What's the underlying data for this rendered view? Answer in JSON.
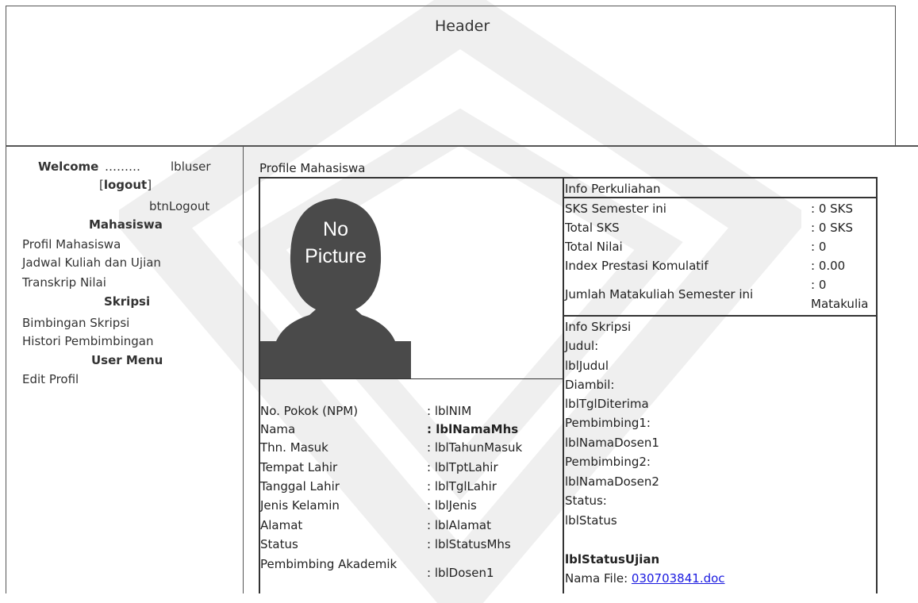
{
  "header": {
    "title": "Header"
  },
  "sidebar": {
    "welcome_label": "Welcome",
    "welcome_dots": "………",
    "user_label": "lbluser",
    "logout_open": "[",
    "logout_label": "logout",
    "logout_close": "]",
    "logout_control": "btnLogout",
    "sections": [
      {
        "title": "Mahasiswa",
        "items": [
          "Profil Mahasiswa",
          "Jadwal Kuliah dan Ujian",
          "Transkrip Nilai"
        ]
      },
      {
        "title": "Skripsi",
        "items": [
          "Bimbingan Skripsi",
          "Histori Pembimbingan"
        ]
      },
      {
        "title": "User Menu",
        "items": [
          "Edit Profil"
        ]
      }
    ]
  },
  "main": {
    "title": "Profile Mahasiswa",
    "photo": {
      "line1": "No",
      "line2": "Picture"
    },
    "profile": [
      {
        "label": "No. Pokok (NPM)",
        "value": ": lblNIM"
      },
      {
        "label": "Nama",
        "value": ": lblNamaMhs"
      },
      {
        "label": "Thn. Masuk",
        "value": ": lblTahunMasuk"
      },
      {
        "label": "Tempat Lahir",
        "value": ": lblTptLahir"
      },
      {
        "label": "Tanggal Lahir",
        "value": ": lblTglLahir"
      },
      {
        "label": "Jenis Kelamin",
        "value": ": lblJenis"
      },
      {
        "label": "Alamat",
        "value": ": lblAlamat"
      },
      {
        "label": "Status",
        "value": ": lblStatusMhs"
      },
      {
        "label": "Pembimbing Akademik",
        "value": ": lblDosen1"
      }
    ],
    "info_perkuliahan": {
      "title": "Info Perkuliahan",
      "rows": [
        {
          "label": "SKS Semester ini",
          "value": ": 0 SKS"
        },
        {
          "label": "Total SKS",
          "value": ": 0 SKS"
        },
        {
          "label": "Total Nilai",
          "value": ": 0"
        },
        {
          "label": "Index Prestasi Komulatif",
          "value": ": 0.00"
        },
        {
          "label": "Jumlah Matakuliah Semester ini",
          "value_line1": ": 0",
          "value_line2": "Matakulia"
        }
      ]
    },
    "info_skripsi": {
      "title": "Info Skripsi",
      "lines": [
        "Judul:",
        "lblJudul",
        "Diambil:",
        "lblTglDiterima",
        "Pembimbing1:",
        "lblNamaDosen1",
        "Pembimbing2:",
        "lblNamaDosen2",
        "Status:",
        "lblStatus"
      ],
      "status_ujian": "lblStatusUjian",
      "file_label": "Nama File:",
      "file_link": "030703841.doc"
    }
  },
  "colors": {
    "line": "#333333",
    "link": "#1a1ae0",
    "silhouette": "#4a4a4a"
  }
}
